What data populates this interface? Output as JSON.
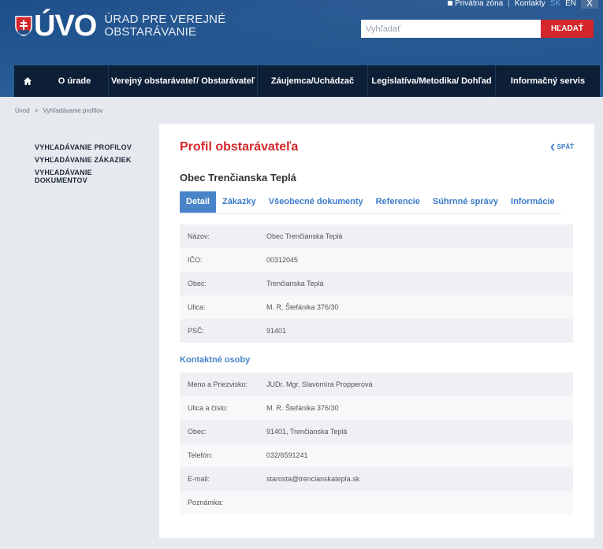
{
  "topbar": {
    "private_zone": "Privátna zóna",
    "contacts": "Kontakty",
    "lang_sk": "SK",
    "lang_en": "EN",
    "close": "X"
  },
  "logo": {
    "letters": "ÚVO",
    "line1": "ÚRAD PRE VEREJNÉ",
    "line2": "OBSTARÁVANIE"
  },
  "search": {
    "placeholder": "Vyhľadať",
    "button": "HĽADAŤ"
  },
  "nav": {
    "items": [
      {
        "label": "O úrade"
      },
      {
        "label": "Verejný obstarávateľ/ Obstarávateľ"
      },
      {
        "label": "Záujemca/Uchádzač"
      },
      {
        "label": "Legislatíva/Metodika/ Dohľad"
      },
      {
        "label": "Informačný servis"
      }
    ]
  },
  "breadcrumb": {
    "home": "Úvod",
    "sep": ">",
    "current": "Vyhľadávanie profilov"
  },
  "sidebar": {
    "items": [
      {
        "label": "VYHĽADÁVANIE PROFILOV"
      },
      {
        "label": "VYHĽADÁVANIE ZÁKAZIEK"
      },
      {
        "label": "VYHĽADÁVANIE DOKUMENTOV"
      }
    ]
  },
  "main": {
    "title": "Profil obstarávateľa",
    "back": "SPÄŤ",
    "subtitle": "Obec Trenčianska Teplá",
    "tabs": [
      {
        "label": "Detail"
      },
      {
        "label": "Zákazky"
      },
      {
        "label": "Všeobecné dokumenty"
      },
      {
        "label": "Referencie"
      },
      {
        "label": "Súhrnné správy"
      },
      {
        "label": "Informácie"
      }
    ],
    "details": [
      {
        "key": "Názov:",
        "value": "Obec Trenčianska Teplá"
      },
      {
        "key": "IČO:",
        "value": "00312045"
      },
      {
        "key": "Obec:",
        "value": "Trenčianska Teplá"
      },
      {
        "key": "Ulica:",
        "value": "M. R. Štefánika 376/30"
      },
      {
        "key": "PSČ:",
        "value": "91401"
      }
    ],
    "contacts_title": "Kontaktné osoby",
    "contacts": [
      {
        "key": "Meno a Priezvisko:",
        "value": "JUDr. Mgr. Slavomíra Propperová"
      },
      {
        "key": "Ulica a číslo:",
        "value": "M. R. Štefánika 376/30"
      },
      {
        "key": "Obec:",
        "value": "91401, Trenčianska Teplá"
      },
      {
        "key": "Telefón:",
        "value": "032/6591241"
      },
      {
        "key": "E-mail:",
        "value": "starosta@trencianskatepla.sk"
      },
      {
        "key": "Poznámka:",
        "value": ""
      }
    ]
  }
}
